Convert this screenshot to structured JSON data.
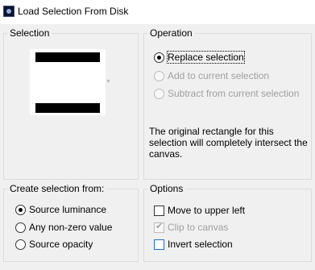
{
  "window": {
    "title": "Load Selection From Disk"
  },
  "selection_group": {
    "legend": "Selection"
  },
  "operation_group": {
    "legend": "Operation",
    "options": [
      {
        "label": "Replace selection",
        "checked": true,
        "enabled": true
      },
      {
        "label": "Add to current selection",
        "checked": false,
        "enabled": false
      },
      {
        "label": "Subtract from current selection",
        "checked": false,
        "enabled": false
      }
    ],
    "description": "The original rectangle for this selection will completely intersect the canvas."
  },
  "create_group": {
    "legend": "Create selection from:",
    "options": [
      {
        "label": "Source luminance",
        "checked": true
      },
      {
        "label": "Any non-zero value",
        "checked": false
      },
      {
        "label": "Source opacity",
        "checked": false
      }
    ]
  },
  "options_group": {
    "legend": "Options",
    "items": [
      {
        "label": "Move to upper left",
        "checked": false,
        "enabled": true
      },
      {
        "label": "Clip to canvas",
        "checked": true,
        "enabled": false
      },
      {
        "label": "Invert selection",
        "checked": false,
        "enabled": true
      }
    ]
  }
}
